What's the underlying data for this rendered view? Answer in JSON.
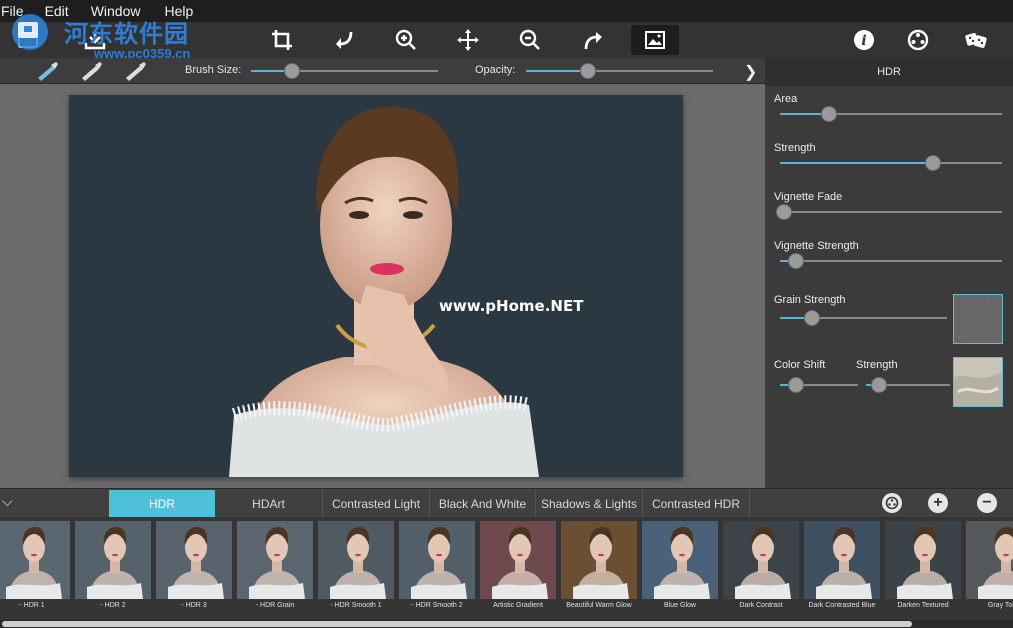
{
  "menu": [
    "File",
    "Edit",
    "Window",
    "Help"
  ],
  "watermark": {
    "text": "河东软件园",
    "url": "www.pc0359.cn"
  },
  "toolbar": {
    "icons": [
      "open-icon",
      "save-icon",
      "crop-icon",
      "rotate-left-icon",
      "zoom-in-icon",
      "move-icon",
      "zoom-out-icon",
      "rotate-right-icon",
      "image-view-icon",
      "info-icon",
      "settings-icon",
      "random-icon"
    ]
  },
  "options": {
    "brush_size_label": "Brush Size:",
    "brush_size_value": 0.22,
    "opacity_label": "Opacity:",
    "opacity_value": 0.33
  },
  "photo_watermark": "www.pHome.NET",
  "panel": {
    "title": "HDR",
    "sliders": [
      {
        "label": "Area",
        "value": 0.22
      },
      {
        "label": "Strength",
        "value": 0.69
      },
      {
        "label": "Vignette Fade",
        "value": 0.02
      },
      {
        "label": "Vignette Strength",
        "value": 0.07
      },
      {
        "label": "Grain Strength",
        "value": 0.19
      }
    ],
    "color_shift_label": "Color Shift",
    "color_shift_value": 0.2,
    "color_strength_label": "Strength",
    "color_strength_value": 0.15
  },
  "tabs": {
    "items": [
      "HDR",
      "HDArt",
      "Contrasted Light",
      "Black And White",
      "Shadows & Lights",
      "Contrasted HDR"
    ],
    "active": 0,
    "buttons": [
      "favorite-icon",
      "add-icon",
      "remove-icon"
    ]
  },
  "presets": [
    {
      "label": "- HDR 1",
      "tint": "#5a6670"
    },
    {
      "label": "- HDR 2",
      "tint": "#56626b"
    },
    {
      "label": "- HDR 3",
      "tint": "#58636d"
    },
    {
      "label": "- HDR Grain",
      "tint": "#5b6570"
    },
    {
      "label": "- HDR Smooth 1",
      "tint": "#4f5a63"
    },
    {
      "label": "- HDR Smooth 2",
      "tint": "#535f69"
    },
    {
      "label": "Artistic Gradient",
      "tint": "#6e4a4e"
    },
    {
      "label": "Beautiful Warm Glow",
      "tint": "#6a5030"
    },
    {
      "label": "Blue Glow",
      "tint": "#4a6178"
    },
    {
      "label": "Dark Contrast",
      "tint": "#3d4449"
    },
    {
      "label": "Dark Contrasted Blue",
      "tint": "#3f5060"
    },
    {
      "label": "Darken Textured",
      "tint": "#3b4248"
    },
    {
      "label": "Gray Tone",
      "tint": "#55585b"
    }
  ]
}
